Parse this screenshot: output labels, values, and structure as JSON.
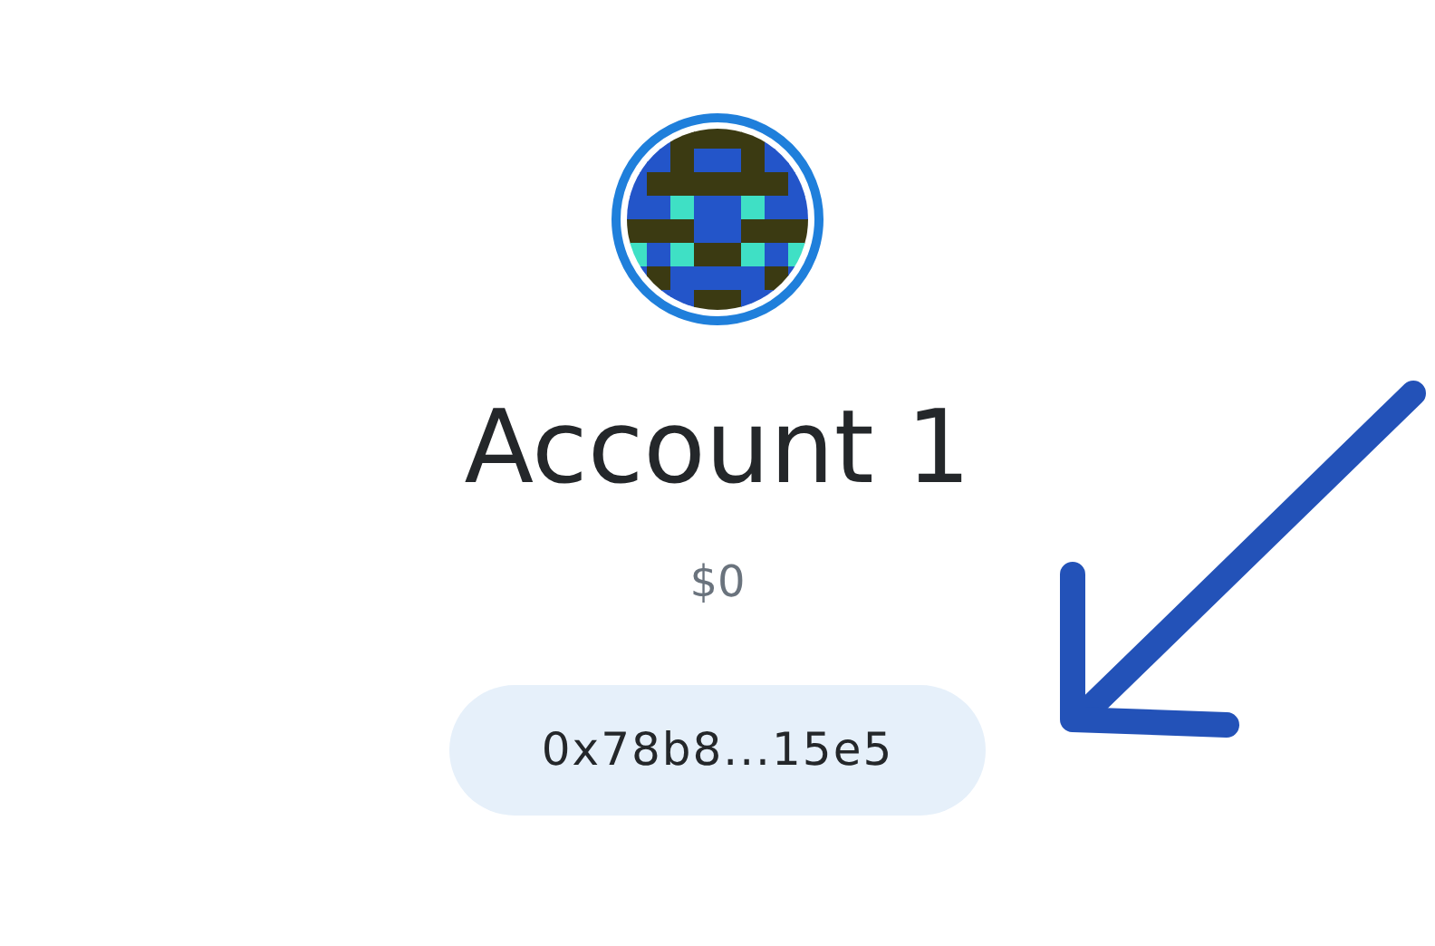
{
  "account": {
    "name": "Account 1",
    "balance": "$0",
    "address": "0x78b8...15e5"
  }
}
